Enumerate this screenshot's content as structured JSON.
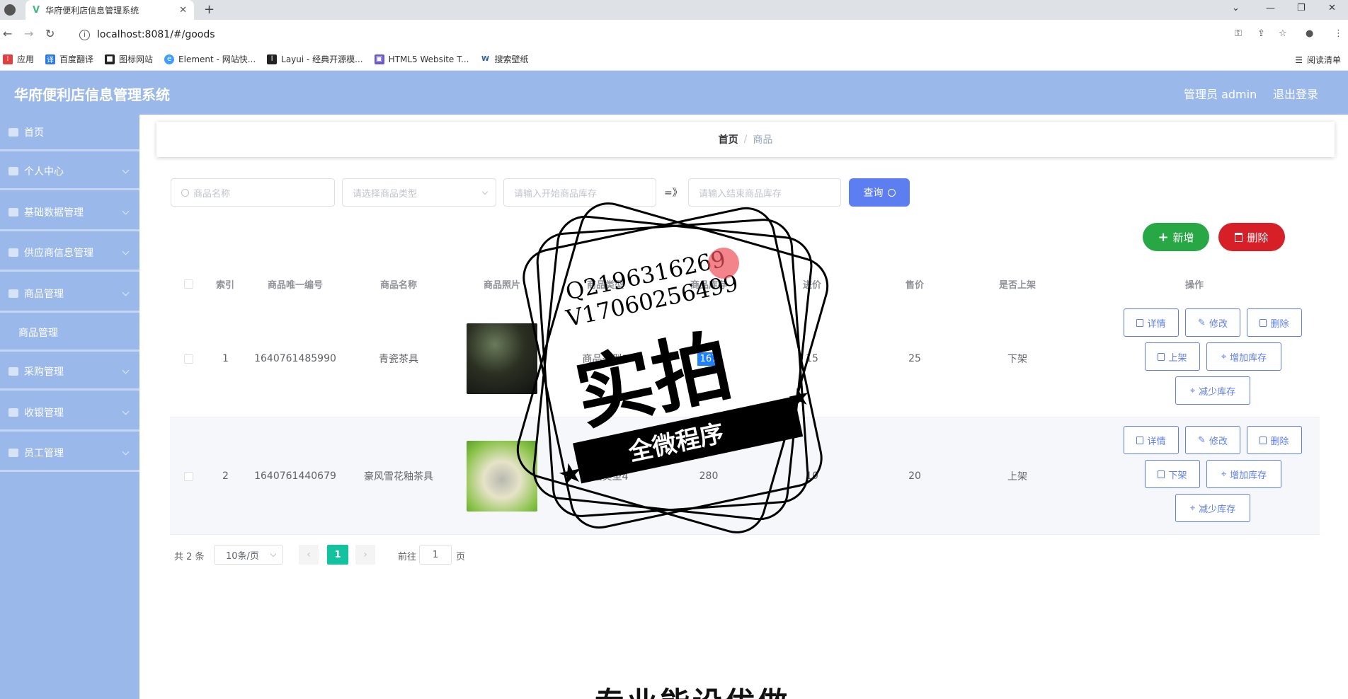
{
  "browser": {
    "tab_title": "华府便利店信息管理系统",
    "url": "localhost:8081/#/goods",
    "bookmarks": [
      "应用",
      "百度翻译",
      "图标网站",
      "Element - 网站快...",
      "Layui - 经典开源模...",
      "HTML5 Website T...",
      "搜索壁纸"
    ],
    "reading_list": "阅读清单"
  },
  "header": {
    "title": "华府便利店信息管理系统",
    "admin": "管理员 admin",
    "logout": "退出登录"
  },
  "sidebar": {
    "items": [
      {
        "label": "首页"
      },
      {
        "label": "个人中心"
      },
      {
        "label": "基础数据管理"
      },
      {
        "label": "供应商信息管理"
      },
      {
        "label": "商品管理"
      },
      {
        "label": "商品管理"
      },
      {
        "label": "采购管理"
      },
      {
        "label": "收银管理"
      },
      {
        "label": "员工管理"
      }
    ]
  },
  "breadcrumb": {
    "home": "首页",
    "sep": "/",
    "current": "商品"
  },
  "filters": {
    "name_placeholder": "商品名称",
    "type_placeholder": "请选择商品类型",
    "stock_start_placeholder": "请输入开始商品库存",
    "range_sep": "=》",
    "stock_end_placeholder": "请输入结束商品库存",
    "query_label": "查询"
  },
  "actions": {
    "add_label": "新增",
    "delete_label": "删除"
  },
  "table": {
    "headers": [
      "索引",
      "商品唯一编号",
      "商品名称",
      "商品照片",
      "商品类型",
      "商品库存",
      "进价",
      "售价",
      "是否上架",
      "操作"
    ],
    "rows": [
      {
        "index": "1",
        "code": "1640761485990",
        "name": "青瓷茶具",
        "type": "商品类型3",
        "stock": "167",
        "buy": "15",
        "sell": "25",
        "status": "下架",
        "toggle": "上架"
      },
      {
        "index": "2",
        "code": "1640761440679",
        "name": "豪风雪花釉茶具",
        "type": "商品类型4",
        "stock": "280",
        "buy": "10",
        "sell": "20",
        "status": "上架",
        "toggle": "下架"
      }
    ],
    "ops": {
      "detail": "详情",
      "edit": "修改",
      "delete": "删除",
      "add_stock": "增加库存",
      "reduce_stock": "减少库存"
    }
  },
  "pager": {
    "total": "共 2 条",
    "size": "10条/页",
    "page": "1",
    "goto": "前往",
    "goto_value": "1",
    "unit": "页"
  },
  "watermark": {
    "line1": "Q2196316269",
    "line2": "V17060256499",
    "big": "实拍",
    "band": "全微程序"
  },
  "bottom_text": "专业能设优做"
}
